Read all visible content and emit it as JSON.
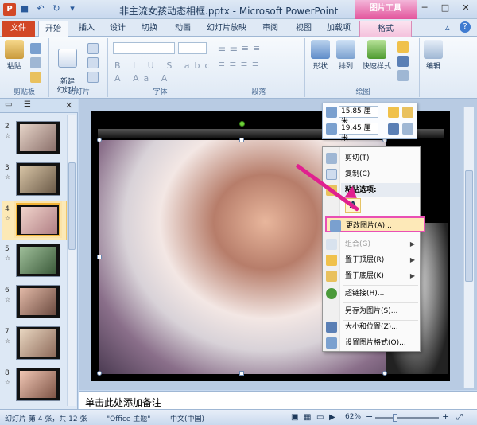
{
  "window": {
    "title": "非主流女孩动态相框.pptx - Microsoft PowerPoint",
    "context_tab_header": "图片工具"
  },
  "tabs": [
    {
      "label": "文件"
    },
    {
      "label": "开始"
    },
    {
      "label": "插入"
    },
    {
      "label": "设计"
    },
    {
      "label": "切换"
    },
    {
      "label": "动画"
    },
    {
      "label": "幻灯片放映"
    },
    {
      "label": "审阅"
    },
    {
      "label": "视图"
    },
    {
      "label": "加载项"
    },
    {
      "label": "格式"
    }
  ],
  "ribbon": {
    "clipboard": {
      "paste": "粘贴",
      "label": "剪贴板"
    },
    "slides": {
      "new_slide": "新建\n幻灯片",
      "label": "幻灯片"
    },
    "font": {
      "label": "字体"
    },
    "paragraph": {
      "label": "段落"
    },
    "drawing": {
      "shape": "形状",
      "arrange": "排列",
      "quick_style": "快速样式",
      "label": "绘图"
    },
    "editing": {
      "edit": "编辑"
    }
  },
  "left_pane": {
    "thumbnails": [
      {
        "num": "2"
      },
      {
        "num": "3"
      },
      {
        "num": "4"
      },
      {
        "num": "5"
      },
      {
        "num": "6"
      },
      {
        "num": "7"
      },
      {
        "num": "8"
      }
    ]
  },
  "mini_toolbar": {
    "height": "15.85 厘米",
    "width": "19.45 厘米"
  },
  "context_menu": {
    "items": [
      {
        "label": "剪切(T)"
      },
      {
        "label": "复制(C)"
      },
      {
        "label": "粘贴选项:"
      },
      {
        "label": "更改图片(A)..."
      },
      {
        "label": "组合(G)"
      },
      {
        "label": "置于顶层(R)"
      },
      {
        "label": "置于底层(K)"
      },
      {
        "label": "超链接(H)..."
      },
      {
        "label": "另存为图片(S)..."
      },
      {
        "label": "大小和位置(Z)..."
      },
      {
        "label": "设置图片格式(O)..."
      }
    ],
    "paste_option_glyph": "A"
  },
  "notes": {
    "placeholder": "单击此处添加备注"
  },
  "status": {
    "slide_info": "幻灯片 第 4 张，共 12 张",
    "theme": "\"Office 主题\"",
    "language": "中文(中国)",
    "zoom": "62%"
  },
  "colors": {
    "accent_file_tab": "#d24726",
    "context_tab": "#e3559c",
    "highlight_border": "#e94fb4",
    "arrow": "#e0208f"
  }
}
